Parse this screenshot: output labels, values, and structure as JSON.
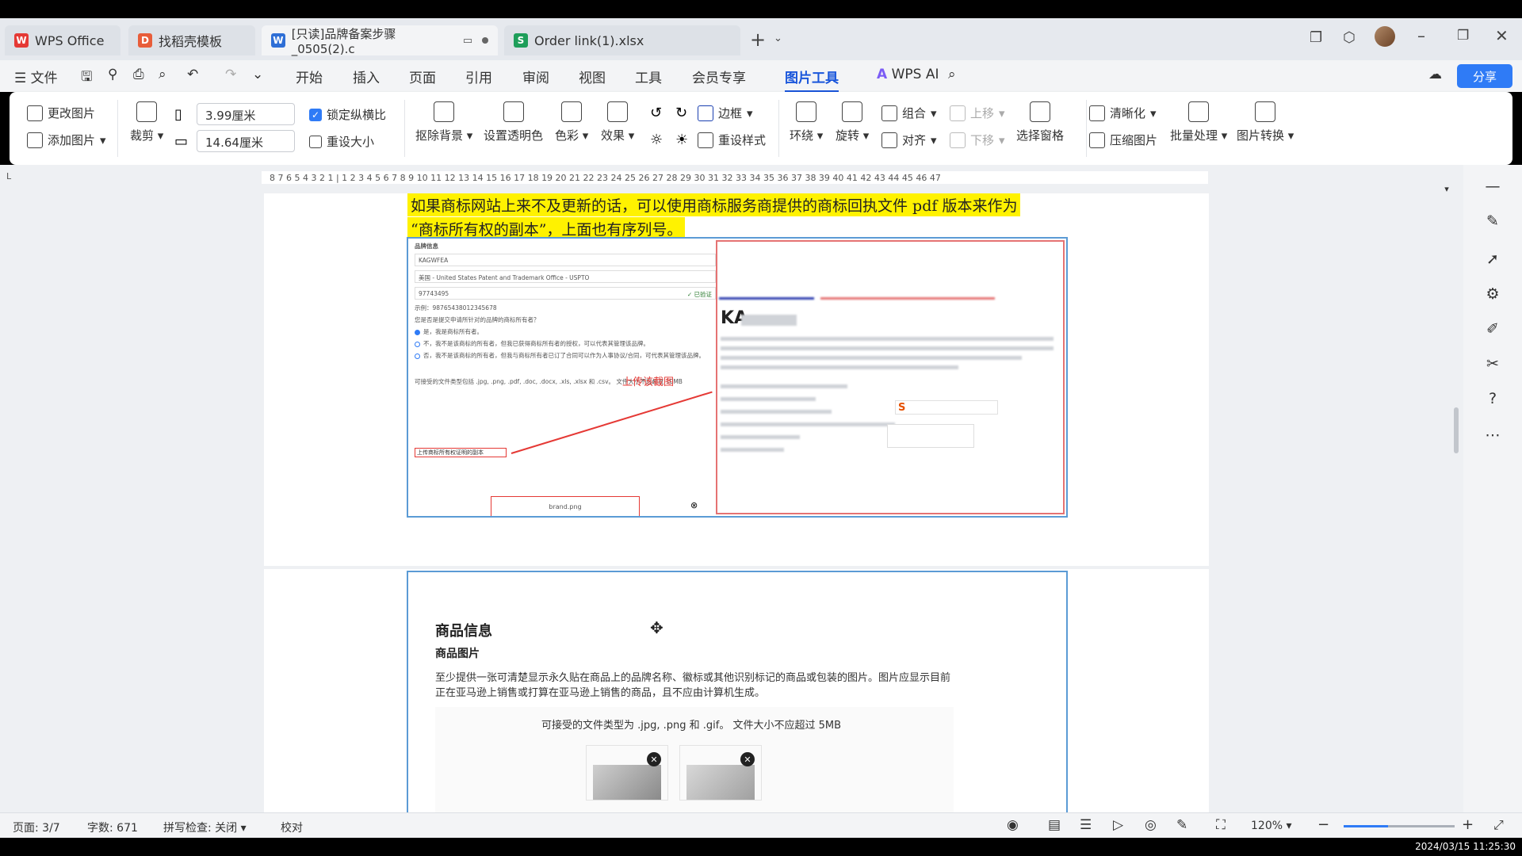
{
  "timestamp": "2024/03/15 11:25:30",
  "tabs": [
    {
      "label": "WPS Office",
      "icon": "wps-logo-icon"
    },
    {
      "label": "找稻壳模板",
      "icon": "daoke-icon"
    },
    {
      "label": "[只读]品牌备案步骤_0505(2).c",
      "icon": "word-doc-icon"
    },
    {
      "label": "Order link(1).xlsx",
      "icon": "sheet-icon"
    }
  ],
  "menu": {
    "file": "文件",
    "items": [
      "开始",
      "插入",
      "页面",
      "引用",
      "审阅",
      "视图",
      "工具",
      "会员专享",
      "图片工具"
    ],
    "active": "图片工具",
    "wps_ai": "WPS AI",
    "share": "分享"
  },
  "ribbon": {
    "change_image": "更改图片",
    "add_image": "添加图片",
    "crop": "裁剪",
    "height_value": "3.99厘米",
    "width_value": "14.64厘米",
    "lock_ratio": "锁定纵横比",
    "reset_size": "重设大小",
    "remove_bg": "抠除背景",
    "set_transparent": "设置透明色",
    "color": "色彩",
    "effects": "效果",
    "border": "边框",
    "reset_style": "重设样式",
    "wrap": "环绕",
    "rotate": "旋转",
    "group": "组合",
    "align": "对齐",
    "move_up": "上移",
    "move_down": "下移",
    "selection_pane": "选择窗格",
    "clarity": "清晰化",
    "compress": "压缩图片",
    "batch": "批量处理",
    "convert": "图片转换"
  },
  "ruler": "8 7 6 5 4 3 2 1 | 1 2 3 4 5 6 7 8 9 10 11 12 13 14 15 16 17 18 19 20 21 22 23 24 25 26 27 28 29 30 31 32 33 34 35 36 37 38 39 40 41 42 43 44 45 46 47",
  "doc": {
    "highlight_line1": "如果商标网站上来不及更新的话，可以使用商标服务商提供的商标回执文件 pdf 版本来作为",
    "highlight_line2": "“商标所有权的副本”，上面也有序列号。",
    "form_brand_name": "KAGWFEA",
    "form_office": "美国 - United States Patent and Trademark Office - USPTO",
    "form_serial": "97743495",
    "form_verified": "✓ 已验证",
    "form_example": "示例：98765438012345678",
    "form_q": "您是否是提交申请所针对的品牌的商标所有者？",
    "form_opt1": "是，我是商标所有者。",
    "form_opt2": "不，我不是该商标的所有者，但我已获得商标所有者的授权，可以代表其管理该品牌。",
    "form_opt3": "否，我不是该商标的所有者，但我与商标所有者已订了合同可以作为人事协议/合同，可代表其管理该品牌。",
    "upload_label": "上传该截图",
    "upload_copy": "上传商标所有权证明的副本",
    "accept_types": "可接受的文件类型包括 .jpg, .png, .pdf, .doc, .docx, .xls, .xlsx 和 .csv。   文件大小不应超过 10MB",
    "brand_file": "brand.png",
    "tm_mark": "KA",
    "section_title": "商品信息",
    "section_sub": "商品图片",
    "section_body": "至少提供一张可清楚显示永久贴在商品上的品牌名称、徽标或其他识别标记的商品或包装的图片。图片应显示目前正在亚马逊上销售或打算在亚马逊上销售的商品，且不应由计算机生成。",
    "section_accept": "可接受的文件类型为 .jpg, .png 和 .gif。    文件大小不应超过 5MB"
  },
  "status": {
    "page": "页面: 3/7",
    "words": "字数: 671",
    "spell": "拼写检查: 关闭",
    "proof": "校对",
    "zoom": "120%",
    "zoom_fraction": 0.4
  }
}
